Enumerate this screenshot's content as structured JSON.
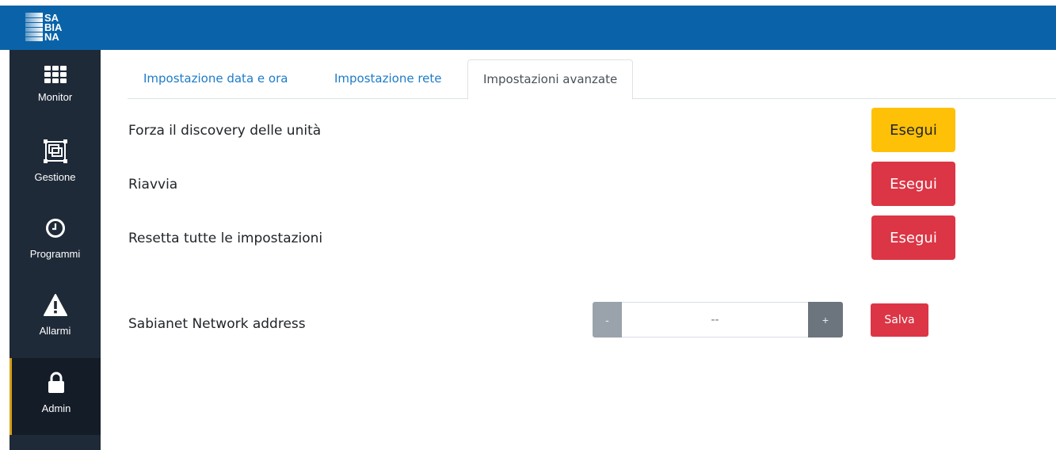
{
  "header": {
    "logo": {
      "letters": [
        "SA",
        "BIA",
        "NA"
      ],
      "brand_color": "#0a63a8"
    }
  },
  "sidebar": {
    "items": [
      {
        "label": "Monitor",
        "icon": "grid-icon"
      },
      {
        "label": "Gestione",
        "icon": "screens-icon"
      },
      {
        "label": "Programmi",
        "icon": "clock-icon"
      },
      {
        "label": "Allarmi",
        "icon": "warning-icon"
      },
      {
        "label": "Admin",
        "icon": "lock-icon",
        "active": true
      }
    ]
  },
  "tabs": [
    {
      "label": "Impostazione data e ora"
    },
    {
      "label": "Impostazione rete"
    },
    {
      "label": "Impostazioni avanzate",
      "active": true
    }
  ],
  "actions": [
    {
      "label": "Forza il discovery delle unità",
      "button": "Esegui",
      "color": "#ffc107"
    },
    {
      "label": "Riavvia",
      "button": "Esegui",
      "color": "#dc3545"
    },
    {
      "label": "Resetta tutte le impostazioni",
      "button": "Esegui",
      "color": "#dc3545"
    }
  ],
  "network": {
    "label": "Sabianet Network address",
    "value": "--",
    "minus": "-",
    "plus": "+",
    "save": "Salva"
  }
}
